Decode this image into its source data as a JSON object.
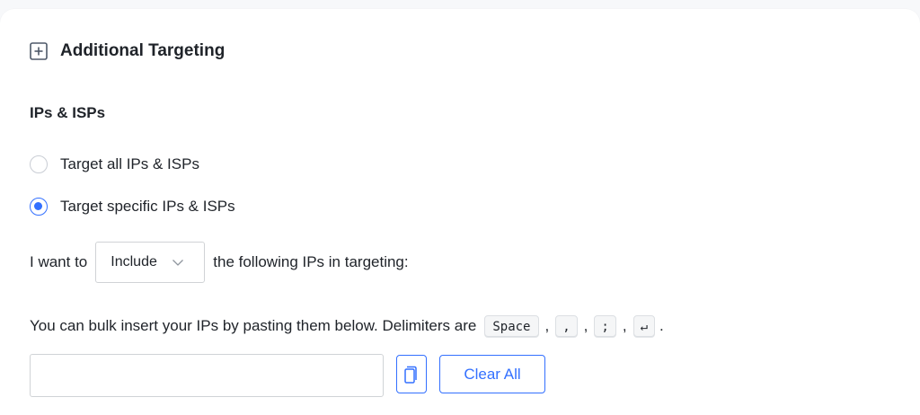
{
  "section": {
    "title": "Additional Targeting",
    "expand_icon": "plus-square-icon"
  },
  "ips": {
    "heading": "IPs & ISPs",
    "options": [
      {
        "label": "Target all IPs & ISPs",
        "checked": false
      },
      {
        "label": "Target specific IPs & ISPs",
        "checked": true
      }
    ]
  },
  "targeting": {
    "prefix": "I want to",
    "mode_selected": "Include",
    "suffix": "the following IPs in targeting:"
  },
  "bulk": {
    "text": "You can bulk insert your IPs by pasting them below. Delimiters are",
    "delimiters": [
      "Space",
      ",",
      ";",
      "↵"
    ],
    "separator": ",",
    "end": "."
  },
  "input": {
    "value": "",
    "placeholder": ""
  },
  "buttons": {
    "copy_icon": "copy-icon",
    "clear_label": "Clear All"
  },
  "colors": {
    "accent": "#3370ff",
    "border": "#d0d3d6",
    "text": "#1f2329"
  }
}
